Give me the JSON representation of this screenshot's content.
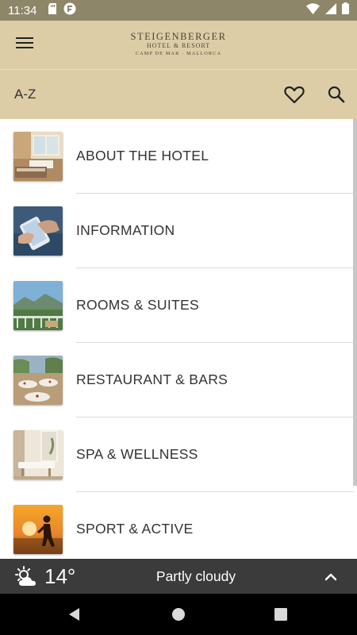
{
  "status_bar": {
    "time": "11:34",
    "left_icons": [
      "sd-card-icon",
      "app-notification-icon"
    ],
    "right_icons": [
      "wifi-icon",
      "cell-signal-icon",
      "battery-icon"
    ]
  },
  "header": {
    "brand": "STEIGENBERGER",
    "subtitle": "HOTEL & RESORT",
    "location": "CAMP DE MAR · MALLORCA"
  },
  "toolbar": {
    "az_label": "A-Z"
  },
  "menu_items": [
    {
      "label": "ABOUT THE HOTEL",
      "thumb": "hotel-room-photo"
    },
    {
      "label": "INFORMATION",
      "thumb": "smartphone-hand-photo"
    },
    {
      "label": "ROOMS & SUITES",
      "thumb": "balcony-view-photo"
    },
    {
      "label": "RESTAURANT & BARS",
      "thumb": "restaurant-terrace-photo"
    },
    {
      "label": "SPA & WELLNESS",
      "thumb": "spa-room-photo"
    },
    {
      "label": "SPORT & ACTIVE",
      "thumb": "sunset-runner-photo"
    }
  ],
  "weather": {
    "temperature": "14°",
    "description": "Partly cloudy",
    "icon": "partly-cloudy-icon"
  },
  "colors": {
    "header_bg": "#ddcda7",
    "status_bar_bg": "#8e8669",
    "weather_bar_bg": "#3b3b3b"
  }
}
